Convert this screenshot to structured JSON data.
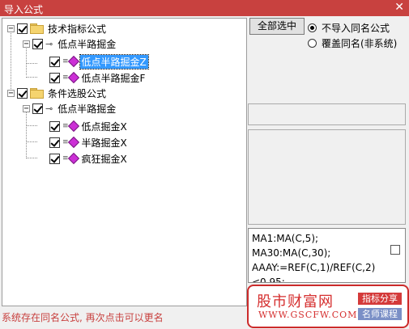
{
  "window": {
    "title": "导入公式",
    "close_glyph": "✕"
  },
  "tree": {
    "groups": [
      {
        "label": "技术指标公式",
        "subgroup": {
          "label": "低点半路掘金",
          "items": [
            "低点半路掘金Z",
            "低点半路掘金F"
          ]
        }
      },
      {
        "label": "条件选股公式",
        "subgroup": {
          "label": "低点半路掘金",
          "items": [
            "低点掘金X",
            "半路掘金X",
            "疯狂掘金X"
          ]
        }
      }
    ],
    "selected_item": "低点半路掘金Z"
  },
  "controls": {
    "select_all_label": "全部选中",
    "radio_no_import": "不导入同名公式",
    "radio_overwrite": "覆盖同名(非系统)",
    "selected_radio": "no_import"
  },
  "code_preview": {
    "lines": [
      "MA1:MA(C,5);",
      "MA30:MA(C,30);",
      "AAAY:=REF(C,1)/REF(C,2)",
      "<0.95;"
    ]
  },
  "status_text": "系统存在同名公式, 再次点击可以更名",
  "watermark": {
    "name": "股市财富网",
    "url": "WWW.GSCFW.COM",
    "tag1": "指标分享",
    "tag2": "名师课程"
  },
  "colors": {
    "title_bar": "#c8413f",
    "selection": "#3399ff",
    "item_diamond": "#cc2fd6",
    "status_text": "#c8413f"
  },
  "icons": {
    "group": "folder-icon",
    "subgroup": "key-icon",
    "item": "formula-diamond-icon"
  }
}
